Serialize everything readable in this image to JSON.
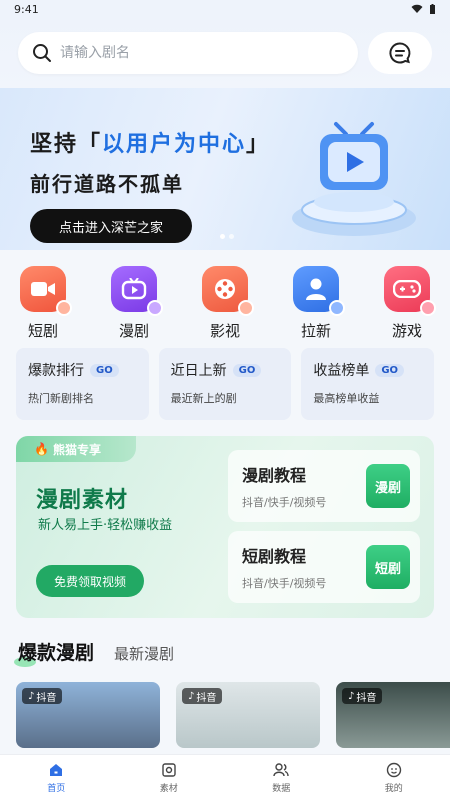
{
  "status": {
    "time": "9:41"
  },
  "search": {
    "placeholder": "请输入剧名"
  },
  "banner": {
    "line1_pre": "坚持「",
    "line1_hl": "以用户为中心",
    "line1_post": "」",
    "line2": "前行道路不孤单",
    "cta": "点击进入深芒之家"
  },
  "categories": [
    {
      "label": "短剧",
      "icon": "video-camera-icon",
      "color": "#f26a4f"
    },
    {
      "label": "漫剧",
      "icon": "tv-play-icon",
      "color": "#8f4cf0"
    },
    {
      "label": "影视",
      "icon": "film-reel-icon",
      "color": "#f06a4a"
    },
    {
      "label": "拉新",
      "icon": "add-user-icon",
      "color": "#3d7bf0"
    },
    {
      "label": "游戏",
      "icon": "gamepad-icon",
      "color": "#f0485e"
    }
  ],
  "quick": [
    {
      "title": "爆款排行",
      "go": "GO",
      "sub": "热门新剧排名"
    },
    {
      "title": "近日上新",
      "go": "GO",
      "sub": "最近新上的剧"
    },
    {
      "title": "收益榜单",
      "go": "GO",
      "sub": "最高榜单收益"
    }
  ],
  "promo": {
    "tag": "熊猫专享",
    "heading": "漫剧素材",
    "sub": "新人易上手·轻松赚收益",
    "button": "免费领取视频",
    "tutorials": [
      {
        "title": "漫剧教程",
        "sub": "抖音/快手/视频号",
        "badge": "漫剧"
      },
      {
        "title": "短剧教程",
        "sub": "抖音/快手/视频号",
        "badge": "短剧"
      }
    ]
  },
  "section": {
    "active": "爆款漫剧",
    "inactive": "最新漫剧"
  },
  "cards": [
    {
      "platform": "抖音"
    },
    {
      "platform": "抖音"
    },
    {
      "platform": "抖音"
    }
  ],
  "tabs": [
    {
      "label": "首页",
      "icon": "home-icon",
      "active": true
    },
    {
      "label": "素材",
      "icon": "material-icon",
      "active": false
    },
    {
      "label": "数据",
      "icon": "users-icon",
      "active": false
    },
    {
      "label": "我的",
      "icon": "profile-icon",
      "active": false
    }
  ]
}
